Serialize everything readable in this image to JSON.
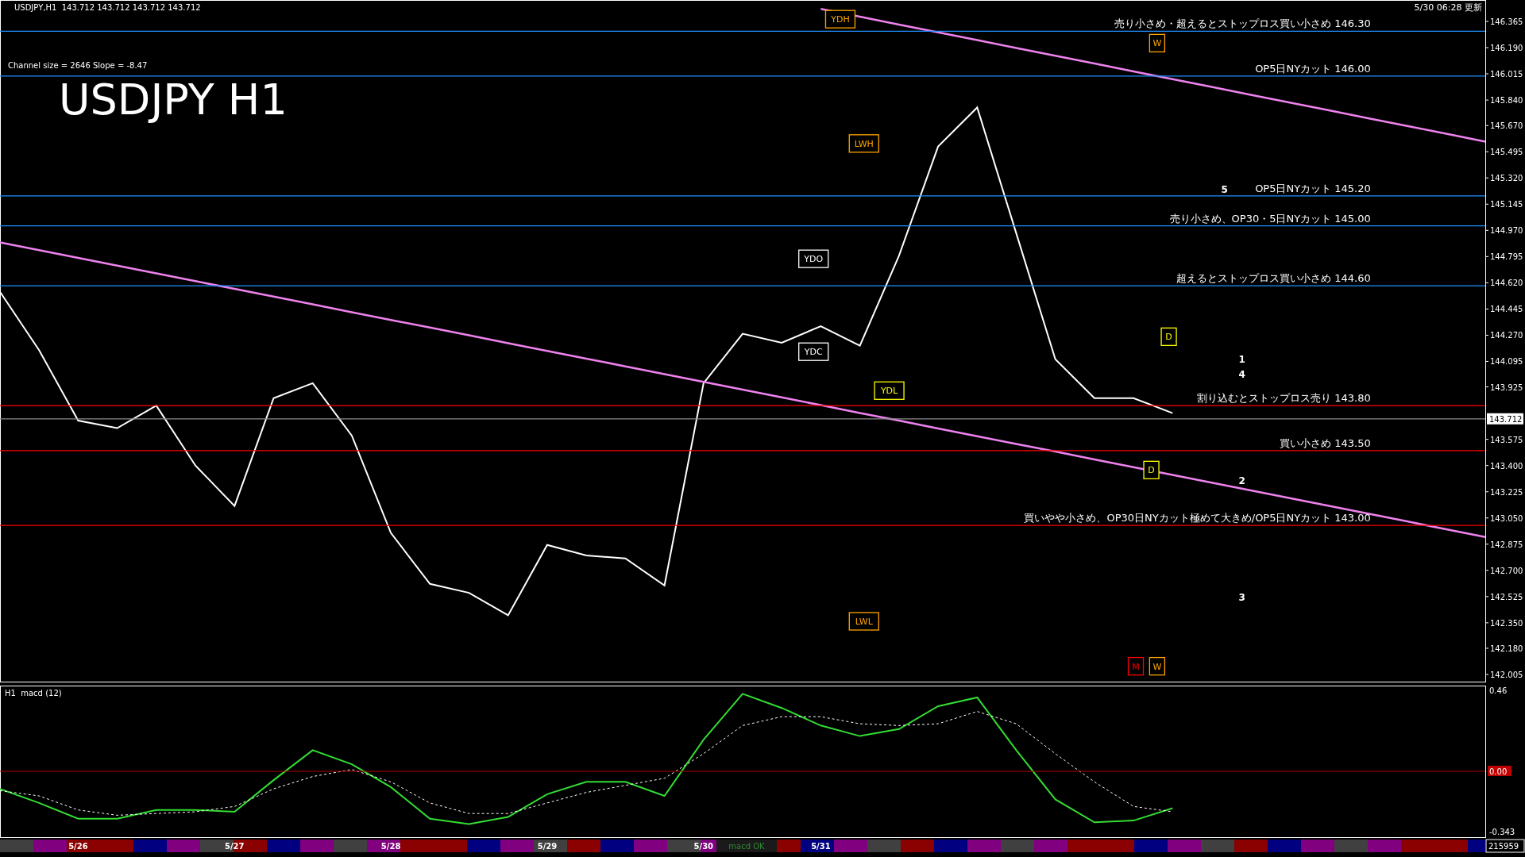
{
  "header": {
    "symbol_line": "USDJPY,H1  143.712 143.712 143.712 143.712",
    "channel_info": "Channel size = 2646 Slope = -8.47",
    "title": "USDJPY H1",
    "updated": "5/30 06:28 更新"
  },
  "price_chart": {
    "last_price": "143.712",
    "markers": [
      {
        "text": "YDH",
        "color": "#ffa500"
      },
      {
        "text": "W",
        "color": "#ffa500"
      },
      {
        "text": "LWH",
        "color": "#ffa500"
      },
      {
        "text": "YDO",
        "color": "#ffffff"
      },
      {
        "text": "YDC",
        "color": "#ffffff"
      },
      {
        "text": "YDL",
        "color": "#ffff00"
      },
      {
        "text": "D",
        "color": "#ffff00"
      },
      {
        "text": "D",
        "color": "#ffff00"
      },
      {
        "text": "LWL",
        "color": "#ffa500"
      },
      {
        "text": "M",
        "color": "#ff0000"
      },
      {
        "text": "W",
        "color": "#ffa500"
      }
    ],
    "wave_labels": [
      "5",
      "1",
      "4",
      "2",
      "3"
    ],
    "chart_data": {
      "type": "line",
      "ylim": [
        141.952,
        146.508
      ],
      "categories": [
        null,
        null,
        null,
        null,
        null,
        null,
        null,
        null,
        null,
        null,
        null,
        null,
        null,
        null,
        null,
        null,
        null,
        null,
        null,
        null,
        null,
        null,
        null,
        null,
        null,
        null,
        null,
        null,
        null,
        null,
        null,
        null,
        null,
        null,
        null,
        null,
        null,
        null,
        null
      ],
      "series": [
        {
          "color": "#ffffff",
          "values": [
            144.56,
            144.17,
            143.7,
            143.65,
            143.8,
            143.4,
            143.13,
            143.85,
            143.95,
            143.6,
            142.95,
            142.61,
            142.55,
            142.4,
            142.87,
            142.8,
            142.78,
            142.6,
            143.95,
            144.28,
            144.22,
            144.33,
            144.2,
            144.8,
            145.53,
            145.79,
            144.95,
            144.11,
            143.85,
            143.85,
            143.75,
            null,
            null,
            null,
            null,
            null,
            null,
            null,
            null
          ]
        },
        {
          "color": "#ee82ee",
          "values": [
            null,
            null,
            null,
            null,
            null,
            null,
            null,
            null,
            null,
            null,
            null,
            null,
            null,
            null,
            null,
            null,
            null,
            null,
            null,
            null,
            null,
            146.448,
            146.396,
            146.344,
            146.292,
            146.24,
            146.188,
            146.136,
            146.084,
            146.032,
            145.98,
            145.928,
            145.875,
            145.823,
            145.771,
            145.719,
            145.667,
            145.615,
            145.563
          ]
        },
        {
          "color": "#ee82ee",
          "values": [
            144.89,
            144.838,
            144.786,
            144.735,
            144.683,
            144.631,
            144.579,
            144.528,
            144.476,
            144.424,
            144.372,
            144.321,
            144.269,
            144.217,
            144.165,
            144.114,
            144.062,
            144.01,
            143.958,
            143.907,
            143.855,
            143.803,
            143.751,
            143.7,
            143.648,
            143.596,
            143.544,
            143.493,
            143.441,
            143.389,
            143.337,
            143.286,
            143.234,
            143.182,
            143.13,
            143.079,
            143.027,
            142.975,
            142.923
          ]
        },
        {
          "name": "売り小さめ・超えるとストップロス買い小さめ 146.30",
          "color": "#1e90ff",
          "values": [
            146.3,
            146.3,
            146.3,
            146.3,
            146.3,
            146.3,
            146.3,
            146.3,
            146.3,
            146.3,
            146.3,
            146.3,
            146.3,
            146.3,
            146.3,
            146.3,
            146.3,
            146.3,
            146.3,
            146.3,
            146.3,
            146.3,
            146.3,
            146.3,
            146.3,
            146.3,
            146.3,
            146.3,
            146.3,
            146.3,
            146.3,
            146.3,
            146.3,
            146.3,
            146.3,
            146.3,
            146.3,
            146.3,
            146.3
          ]
        },
        {
          "name": "OP5日NYカット 146.00",
          "color": "#1e90ff",
          "values": [
            146,
            146,
            146,
            146,
            146,
            146,
            146,
            146,
            146,
            146,
            146,
            146,
            146,
            146,
            146,
            146,
            146,
            146,
            146,
            146,
            146,
            146,
            146,
            146,
            146,
            146,
            146,
            146,
            146,
            146,
            146,
            146,
            146,
            146,
            146,
            146,
            146,
            146,
            146
          ]
        },
        {
          "name": "OP5日NYカット 145.20",
          "color": "#1e90ff",
          "values": [
            145.2,
            145.2,
            145.2,
            145.2,
            145.2,
            145.2,
            145.2,
            145.2,
            145.2,
            145.2,
            145.2,
            145.2,
            145.2,
            145.2,
            145.2,
            145.2,
            145.2,
            145.2,
            145.2,
            145.2,
            145.2,
            145.2,
            145.2,
            145.2,
            145.2,
            145.2,
            145.2,
            145.2,
            145.2,
            145.2,
            145.2,
            145.2,
            145.2,
            145.2,
            145.2,
            145.2,
            145.2,
            145.2,
            145.2
          ]
        },
        {
          "name": "売り小さめ、OP30・5日NYカット 145.00",
          "color": "#1e90ff",
          "values": [
            145,
            145,
            145,
            145,
            145,
            145,
            145,
            145,
            145,
            145,
            145,
            145,
            145,
            145,
            145,
            145,
            145,
            145,
            145,
            145,
            145,
            145,
            145,
            145,
            145,
            145,
            145,
            145,
            145,
            145,
            145,
            145,
            145,
            145,
            145,
            145,
            145,
            145,
            145
          ]
        },
        {
          "name": "超えるとストップロス買い小さめ 144.60",
          "color": "#1e90ff",
          "values": [
            144.6,
            144.6,
            144.6,
            144.6,
            144.6,
            144.6,
            144.6,
            144.6,
            144.6,
            144.6,
            144.6,
            144.6,
            144.6,
            144.6,
            144.6,
            144.6,
            144.6,
            144.6,
            144.6,
            144.6,
            144.6,
            144.6,
            144.6,
            144.6,
            144.6,
            144.6,
            144.6,
            144.6,
            144.6,
            144.6,
            144.6,
            144.6,
            144.6,
            144.6,
            144.6,
            144.6,
            144.6,
            144.6,
            144.6
          ]
        },
        {
          "name": "割り込むとストップロス売り 143.80",
          "color": "#ff0000",
          "values": [
            143.8,
            143.8,
            143.8,
            143.8,
            143.8,
            143.8,
            143.8,
            143.8,
            143.8,
            143.8,
            143.8,
            143.8,
            143.8,
            143.8,
            143.8,
            143.8,
            143.8,
            143.8,
            143.8,
            143.8,
            143.8,
            143.8,
            143.8,
            143.8,
            143.8,
            143.8,
            143.8,
            143.8,
            143.8,
            143.8,
            143.8,
            143.8,
            143.8,
            143.8,
            143.8,
            143.8,
            143.8,
            143.8,
            143.8
          ]
        },
        {
          "color": "#8c8c8c",
          "values": [
            143.712,
            143.712,
            143.712,
            143.712,
            143.712,
            143.712,
            143.712,
            143.712,
            143.712,
            143.712,
            143.712,
            143.712,
            143.712,
            143.712,
            143.712,
            143.712,
            143.712,
            143.712,
            143.712,
            143.712,
            143.712,
            143.712,
            143.712,
            143.712,
            143.712,
            143.712,
            143.712,
            143.712,
            143.712,
            143.712,
            143.712,
            143.712,
            143.712,
            143.712,
            143.712,
            143.712,
            143.712,
            143.712,
            143.712
          ]
        },
        {
          "name": "買い小さめ 143.50",
          "color": "#ff0000",
          "values": [
            143.5,
            143.5,
            143.5,
            143.5,
            143.5,
            143.5,
            143.5,
            143.5,
            143.5,
            143.5,
            143.5,
            143.5,
            143.5,
            143.5,
            143.5,
            143.5,
            143.5,
            143.5,
            143.5,
            143.5,
            143.5,
            143.5,
            143.5,
            143.5,
            143.5,
            143.5,
            143.5,
            143.5,
            143.5,
            143.5,
            143.5,
            143.5,
            143.5,
            143.5,
            143.5,
            143.5,
            143.5,
            143.5,
            143.5
          ]
        },
        {
          "name": "買いやや小さめ、OP30日NYカット極めて大きめ/OP5日NYカット 143.00",
          "color": "#ff0000",
          "values": [
            143,
            143,
            143,
            143,
            143,
            143,
            143,
            143,
            143,
            143,
            143,
            143,
            143,
            143,
            143,
            143,
            143,
            143,
            143,
            143,
            143,
            143,
            143,
            143,
            143,
            143,
            143,
            143,
            143,
            143,
            143,
            143,
            143,
            143,
            143,
            143,
            143,
            143,
            143
          ]
        }
      ],
      "yticks": [
        {
          "value": 146.365,
          "label": "146.365"
        },
        {
          "value": 146.19,
          "label": "146.190"
        },
        {
          "value": 146.015,
          "label": "146.015"
        },
        {
          "value": 145.84,
          "label": "145.840"
        },
        {
          "value": 145.67,
          "label": "145.670"
        },
        {
          "value": 145.495,
          "label": "145.495"
        },
        {
          "value": 145.32,
          "label": "145.320"
        },
        {
          "value": 145.145,
          "label": "145.145"
        },
        {
          "value": 144.97,
          "label": "144.970"
        },
        {
          "value": 144.795,
          "label": "144.795"
        },
        {
          "value": 144.62,
          "label": "144.620"
        },
        {
          "value": 144.445,
          "label": "144.445"
        },
        {
          "value": 144.27,
          "label": "144.270"
        },
        {
          "value": 144.095,
          "label": "144.095"
        },
        {
          "value": 143.925,
          "label": "143.925"
        },
        {
          "value": 143.575,
          "label": "143.575"
        },
        {
          "value": 143.4,
          "label": "143.400"
        },
        {
          "value": 143.225,
          "label": "143.225"
        },
        {
          "value": 143.05,
          "label": "143.050"
        },
        {
          "value": 142.875,
          "label": "142.875"
        },
        {
          "value": 142.7,
          "label": "142.700"
        },
        {
          "value": 142.525,
          "label": "142.525"
        },
        {
          "value": 142.35,
          "label": "142.350"
        },
        {
          "value": 142.18,
          "label": "142.180"
        },
        {
          "value": 142.005,
          "label": "142.005"
        }
      ]
    }
  },
  "macd_panel": {
    "title": "H1  macd (12)",
    "status": "macd OK",
    "counter": "215959",
    "chart_data": {
      "type": "line",
      "ylim": [
        -0.379,
        0.487
      ],
      "categories": [
        null,
        null,
        "5/26",
        null,
        null,
        null,
        "5/27",
        null,
        null,
        null,
        "5/28",
        null,
        null,
        null,
        "5/29",
        null,
        null,
        null,
        "5/30",
        null,
        null,
        "5/31",
        null,
        null,
        null,
        null,
        null,
        null,
        null,
        null,
        null,
        null,
        null,
        null,
        null,
        null,
        null,
        null,
        null
      ],
      "series": [
        {
          "color": "#33dd33",
          "line_style": "solid",
          "values": [
            -0.1,
            -0.18,
            -0.27,
            -0.27,
            -0.22,
            -0.22,
            -0.23,
            -0.05,
            0.12,
            0.04,
            -0.09,
            -0.27,
            -0.3,
            -0.26,
            -0.13,
            -0.06,
            -0.06,
            -0.14,
            0.18,
            0.44,
            0.36,
            0.26,
            0.2,
            0.24,
            0.37,
            0.42,
            0.12,
            -0.16,
            -0.29,
            -0.28,
            -0.21,
            null,
            null,
            null,
            null,
            null,
            null,
            null,
            null
          ]
        },
        {
          "color": "#ffffff",
          "line_style": "dashed",
          "values": [
            -0.11,
            -0.14,
            -0.22,
            -0.25,
            -0.24,
            -0.23,
            -0.2,
            -0.1,
            -0.03,
            0.01,
            -0.06,
            -0.18,
            -0.24,
            -0.24,
            -0.18,
            -0.12,
            -0.08,
            -0.04,
            0.1,
            0.26,
            0.31,
            0.31,
            0.27,
            0.26,
            0.27,
            0.34,
            0.27,
            0.1,
            -0.06,
            -0.2,
            -0.23,
            null,
            null,
            null,
            null,
            null,
            null,
            null,
            null
          ]
        },
        {
          "color": "#b00000",
          "line_style": "solid",
          "values": [
            0,
            0,
            0,
            0,
            0,
            0,
            0,
            0,
            0,
            0,
            0,
            0,
            0,
            0,
            0,
            0,
            0,
            0,
            0,
            0,
            0,
            0,
            0,
            0,
            0,
            0,
            0,
            0,
            0,
            0,
            0,
            0,
            0,
            0,
            0,
            0,
            0,
            0,
            0
          ]
        }
      ],
      "yticks": [
        {
          "value": 0.46,
          "label": "0.46"
        },
        {
          "value": 0,
          "label": "0.00"
        },
        {
          "value": -0.343,
          "label": "-0.343"
        }
      ]
    }
  }
}
